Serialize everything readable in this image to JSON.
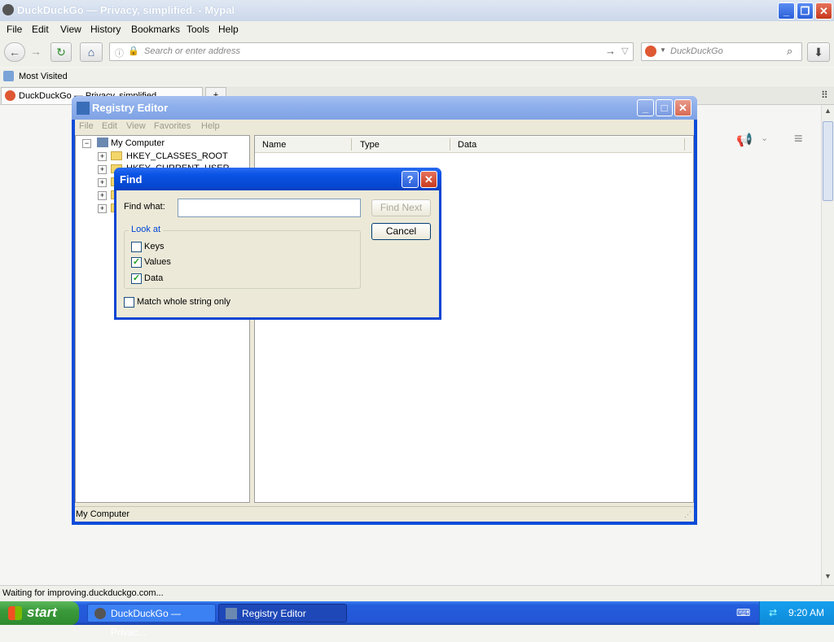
{
  "browser": {
    "title_main": "DuckDuckGo — Privacy, simplified.",
    "title_app": " - Mypal",
    "menus": [
      "File",
      "Edit",
      "View",
      "History",
      "Bookmarks",
      "Tools",
      "Help"
    ],
    "url_placeholder": "Search or enter address",
    "search_engine": "DuckDuckGo",
    "bookmark": "Most Visited",
    "tab_label": "DuckDuckGo — Privacy, simplified.",
    "status": "Waiting for improving.duckduckgo.com..."
  },
  "regedit": {
    "title": "Registry Editor",
    "menus": [
      "File",
      "Edit",
      "View",
      "Favorites",
      "Help"
    ],
    "tree_root": "My Computer",
    "tree_first": "HKEY_CLASSES_ROOT",
    "tree_second": "HKEY_CURRENT_USER",
    "columns": [
      "Name",
      "Type",
      "Data"
    ],
    "status": "My Computer"
  },
  "find": {
    "title": "Find",
    "find_what_label": "Find what:",
    "find_what_value": "",
    "find_next": "Find Next",
    "cancel": "Cancel",
    "look_at": "Look at",
    "keys": "Keys",
    "keys_checked": false,
    "values": "Values",
    "values_checked": true,
    "data": "Data",
    "data_checked": true,
    "match_whole": "Match whole string only",
    "match_checked": false
  },
  "taskbar": {
    "start": "start",
    "task1": "DuckDuckGo — Privac...",
    "task2": "Registry Editor",
    "clock": "9:20 AM"
  },
  "colors": {
    "xp_blue": "#0a54e6",
    "start_green": "#3a9a3a"
  }
}
